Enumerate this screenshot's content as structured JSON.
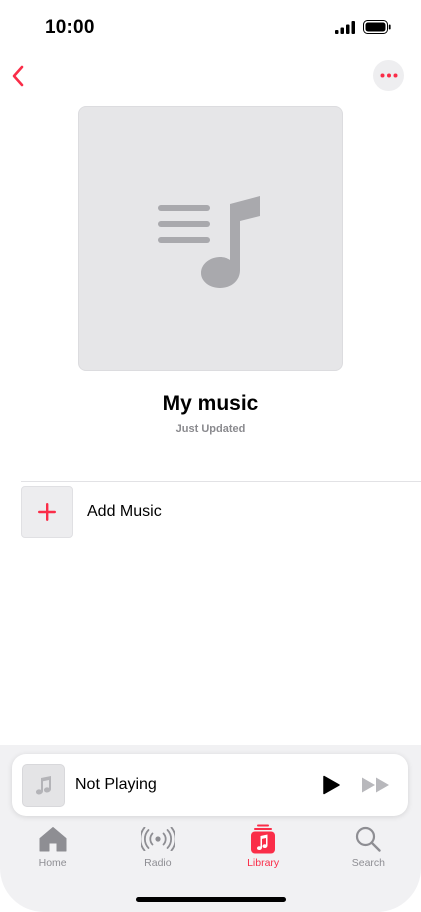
{
  "status_bar": {
    "time": "10:00"
  },
  "nav": {
    "back_icon": "chevron-left-icon",
    "more_icon": "ellipsis-icon"
  },
  "playlist": {
    "title": "My music",
    "subtitle": "Just Updated",
    "artwork_icon": "playlist-music-note-icon"
  },
  "add_music": {
    "label": "Add Music",
    "icon": "plus-icon"
  },
  "mini_player": {
    "title": "Not Playing",
    "play_icon": "play-icon",
    "next_icon": "forward-icon"
  },
  "tabs": [
    {
      "label": "Home",
      "icon": "home-icon",
      "active": false
    },
    {
      "label": "Radio",
      "icon": "radio-icon",
      "active": false
    },
    {
      "label": "Library",
      "icon": "library-icon",
      "active": true
    },
    {
      "label": "Search",
      "icon": "search-icon",
      "active": false
    }
  ],
  "colors": {
    "accent": "#fa2d48",
    "inactive": "#8e8e93",
    "artwork_bg": "#e6e6e8",
    "artwork_icon": "#a9a9ad"
  }
}
